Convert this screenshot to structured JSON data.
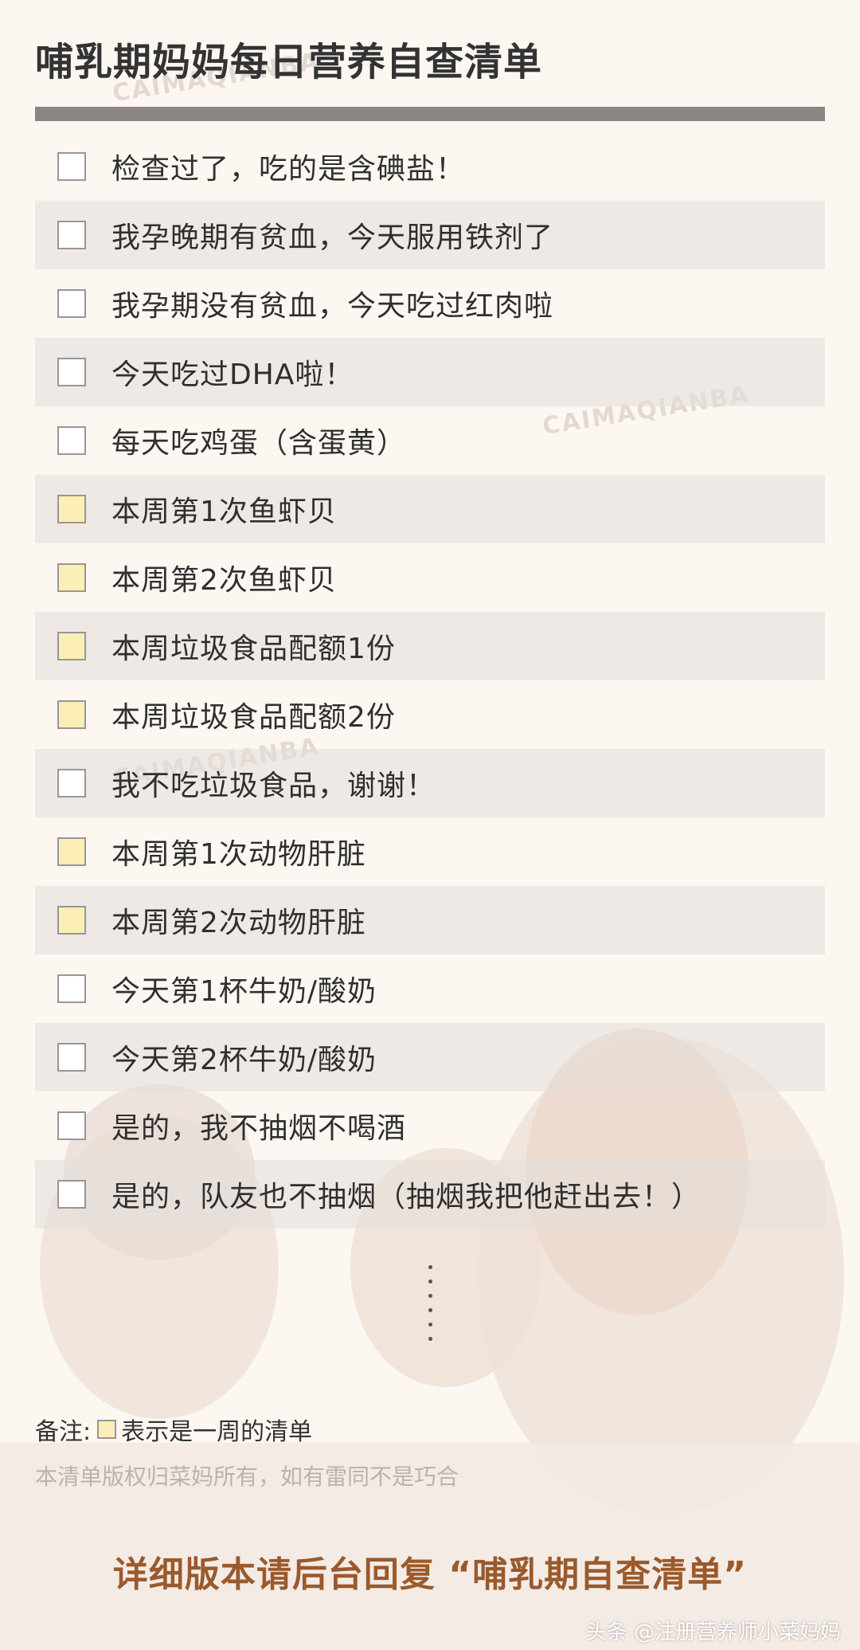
{
  "title": "哺乳期妈妈每日营养自查清单",
  "watermark_text": "CAIMAQIANBA",
  "checklist": [
    {
      "label": "检查过了，吃的是含碘盐！",
      "weekly": false
    },
    {
      "label": "我孕晚期有贫血，今天服用铁剂了",
      "weekly": false
    },
    {
      "label": "我孕期没有贫血，今天吃过红肉啦",
      "weekly": false
    },
    {
      "label": "今天吃过DHA啦！",
      "weekly": false
    },
    {
      "label": "每天吃鸡蛋（含蛋黄）",
      "weekly": false
    },
    {
      "label": "本周第1次鱼虾贝",
      "weekly": true
    },
    {
      "label": "本周第2次鱼虾贝",
      "weekly": true
    },
    {
      "label": "本周垃圾食品配额1份",
      "weekly": true
    },
    {
      "label": "本周垃圾食品配额2份",
      "weekly": true
    },
    {
      "label": "我不吃垃圾食品，谢谢！",
      "weekly": false
    },
    {
      "label": "本周第1次动物肝脏",
      "weekly": true
    },
    {
      "label": "本周第2次动物肝脏",
      "weekly": true
    },
    {
      "label": "今天第1杯牛奶/酸奶",
      "weekly": false
    },
    {
      "label": "今天第2杯牛奶/酸奶",
      "weekly": false
    },
    {
      "label": "是的，我不抽烟不喝酒",
      "weekly": false
    },
    {
      "label": "是的，队友也不抽烟（抽烟我把他赶出去！）",
      "weekly": false
    }
  ],
  "note": {
    "prefix": "备注:",
    "text": "表示是一周的清单"
  },
  "copyright": "本清单版权归菜妈所有，如有雷同不是巧合",
  "cta": "详细版本请后台回复 “哺乳期自查清单”",
  "source": "头条 @注册营养师小菜妈妈",
  "colors": {
    "weekly_box": "#fbefb6",
    "cta": "#9a5a2c",
    "rule": "#8c8583"
  }
}
